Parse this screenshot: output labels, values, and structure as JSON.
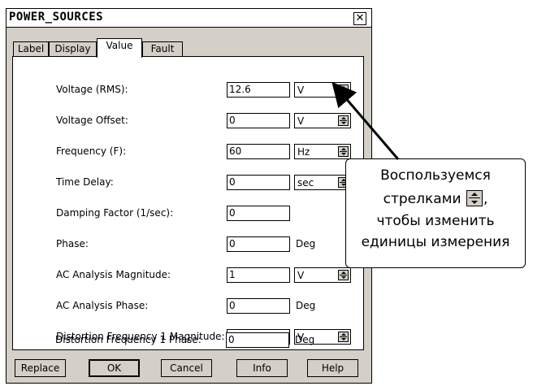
{
  "dialog": {
    "title": "POWER_SOURCES",
    "close_glyph": "✕"
  },
  "tabs": [
    {
      "label": "Label"
    },
    {
      "label": "Display"
    },
    {
      "label": "Value",
      "active": true
    },
    {
      "label": "Fault"
    }
  ],
  "rows": [
    {
      "label": "Voltage (RMS):",
      "value": "12.6",
      "unit": "V"
    },
    {
      "label": "Voltage Offset:",
      "value": "0",
      "unit": "V"
    },
    {
      "label": "Frequency (F):",
      "value": "60",
      "unit": "Hz"
    },
    {
      "label": "Time Delay:",
      "value": "0",
      "unit": "sec"
    },
    {
      "label": "Damping Factor (1/sec):",
      "value": "0"
    },
    {
      "label": "Phase:",
      "value": "0",
      "unit": "Deg"
    },
    {
      "label": "AC Analysis Magnitude:",
      "value": "1",
      "unit": "V"
    },
    {
      "label": "AC Analysis Phase:",
      "value": "0",
      "unit": "Deg"
    },
    {
      "label": "Distortion Frequency 1 Magnitude:",
      "value": "0",
      "unit": "V"
    },
    {
      "label": "Distortion Frequency 1 Phase:",
      "value": "0",
      "unit": "Deg"
    }
  ],
  "buttons": {
    "replace": "Replace",
    "ok": "OK",
    "cancel": "Cancel",
    "info": "Info",
    "help": "Help"
  },
  "callout": {
    "line1": "Воспользуемся",
    "line2_before": "стрелками",
    "line2_after": ",",
    "line3": "чтобы изменить",
    "line4": "единицы измерения"
  }
}
